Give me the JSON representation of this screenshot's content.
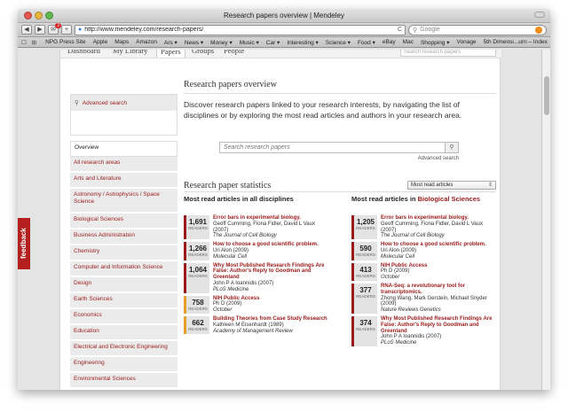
{
  "window": {
    "title": "Research papers overview | Mendeley"
  },
  "toolbar": {
    "back": "◀",
    "forward": "▶",
    "badge_count": "3",
    "url": "http://www.mendeley.com/research-papers/",
    "reload": "C",
    "search_placeholder": "Google"
  },
  "bookmarks": {
    "icons": "☐ ⊞",
    "items": [
      "NPG Press Site",
      "Apple",
      "Maps",
      "Amazon",
      "Ars ▾",
      "News ▾",
      "Money ▾",
      "Music ▾",
      "Car ▾",
      "Interesting ▾",
      "Science ▾",
      "Food ▾",
      "eBay",
      "Mac",
      "Shopping ▾",
      "Vonage",
      "5th Dimensi...urn – Index"
    ]
  },
  "nav": {
    "tabs": [
      "Dashboard",
      "My Library",
      "Papers",
      "Groups",
      "People"
    ],
    "active": "Papers",
    "search_placeholder": "Search research papers"
  },
  "feedback": "feedback",
  "sidebar": {
    "advanced_search": "Advanced search",
    "items": [
      "Overview",
      "All research areas",
      "Arts and Literature",
      "Astronomy / Astrophysics / Space Science",
      "Biological Sciences",
      "Business Administration",
      "Chemistry",
      "Computer and Information Science",
      "Design",
      "Earth Sciences",
      "Economics",
      "Education",
      "Electrical and Electronic Engineering",
      "Engineering",
      "Environmental Sciences"
    ]
  },
  "main": {
    "title": "Research papers overview",
    "intro": "Discover research papers linked to your research interests, by navigating the list of disciplines or by exploring the most read articles and authors in your research area.",
    "search_placeholder": "Search research papers",
    "search_btn": "⚲",
    "advanced_search": "Advanced search",
    "stats_title": "Research paper statistics",
    "stats_select": "Most read articles",
    "stats_select_arrow": "⇕"
  },
  "left_col": {
    "heading": "Most read articles in all disciplines",
    "articles": [
      {
        "count": "1,691",
        "label": "READERS",
        "title": "Error bars in experimental biology.",
        "authors": "Geoff Cumming, Fiona Fidler, David L Vaux (2007)",
        "journal": "The Journal of Cell Biology"
      },
      {
        "count": "1,266",
        "label": "READERS",
        "title": "How to choose a good scientific problem.",
        "authors": "Uri Alon (2009)",
        "journal": "Molecular Cell"
      },
      {
        "count": "1,064",
        "label": "READERS",
        "title": "Why Most Published Research Findings Are False: Author's Reply to Goodman and Greenland",
        "authors": "John P A Ioannidis (2007)",
        "journal": "PLoS Medicine"
      },
      {
        "count": "758",
        "label": "READERS",
        "title": "NIH Public Access",
        "authors": "Ph D (2009)",
        "journal": "October"
      },
      {
        "count": "662",
        "label": "READERS",
        "title": "Building Theories from Case Study Research",
        "authors": "Kathleen M Eisenhardt (1989)",
        "journal": "Academy of Management Review"
      }
    ]
  },
  "right_col": {
    "heading_prefix": "Most read articles in ",
    "heading_field": "Biological Sciences",
    "articles": [
      {
        "count": "1,205",
        "label": "READERS",
        "title": "Error bars in experimental biology.",
        "authors": "Geoff Cumming, Fiona Fidler, David L Vaux (2007)",
        "journal": "The Journal of Cell Biology"
      },
      {
        "count": "590",
        "label": "READERS",
        "title": "How to choose a good scientific problem.",
        "authors": "Uri Alon (2009)",
        "journal": "Molecular Cell"
      },
      {
        "count": "413",
        "label": "READERS",
        "title": "NIH Public Access",
        "authors": "Ph D (2009)",
        "journal": "October"
      },
      {
        "count": "377",
        "label": "READERS",
        "title": "RNA-Seq: a revolutionary tool for transcriptomics.",
        "authors": "Zhong Wang, Mark Gerstein, Michael Snyder (2009)",
        "journal": "Nature Reviews Genetics"
      },
      {
        "count": "374",
        "label": "READERS",
        "title": "Why Most Published Research Findings Are False: Author's Reply to Goodman and Greenland",
        "authors": "John P A Ioannidis (2007)",
        "journal": "PLoS Medicine"
      }
    ]
  }
}
